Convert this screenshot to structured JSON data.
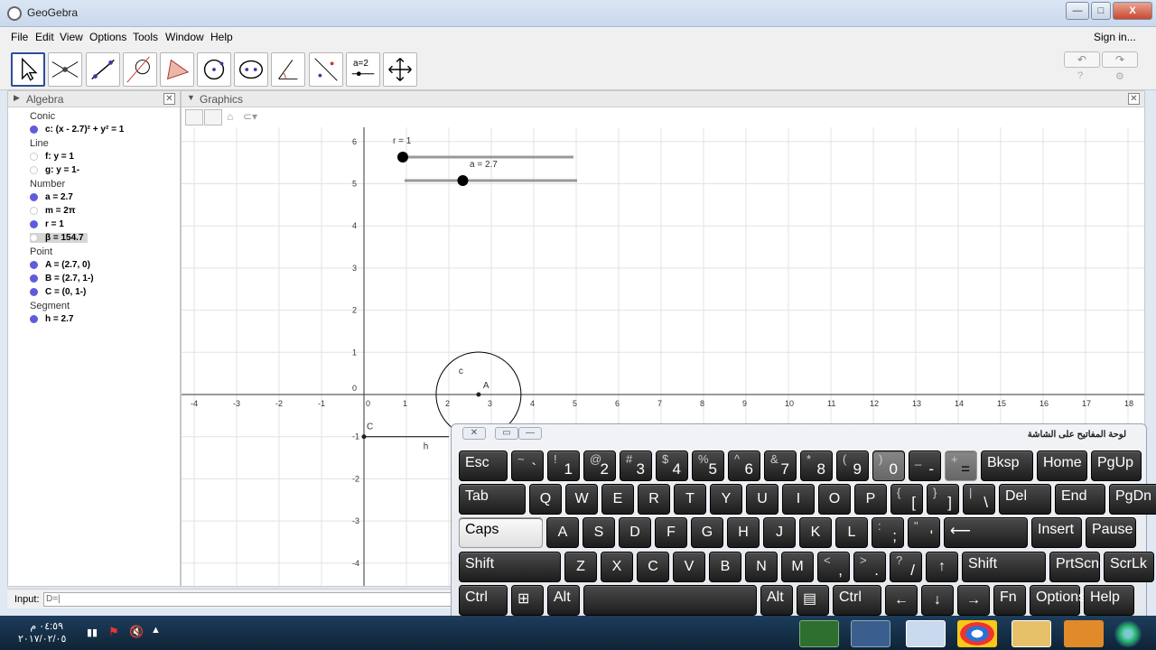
{
  "window": {
    "title": "GeoGebra",
    "min": "—",
    "max": "□",
    "close": "X"
  },
  "menu": [
    "File",
    "Edit",
    "View",
    "Options",
    "Tools",
    "Window",
    "Help"
  ],
  "signin": "Sign in...",
  "toolbar": {
    "slider_label": "a=2"
  },
  "algebra": {
    "title": "Algebra",
    "categories": {
      "conic": "Conic",
      "line": "Line",
      "number": "Number",
      "point": "Point",
      "segment": "Segment"
    },
    "items": [
      {
        "text": "c: (x - 2.7)² + y² = 1",
        "visible": true
      },
      {
        "text": "f: y = 1",
        "visible": false
      },
      {
        "text": "g: y = 1-",
        "visible": false
      },
      {
        "text": "a = 2.7",
        "visible": true
      },
      {
        "text": "m = 2π",
        "visible": false
      },
      {
        "text": "r = 1",
        "visible": true
      },
      {
        "text": "β = 154.7",
        "visible": false
      },
      {
        "text": "A = (2.7, 0)",
        "visible": true
      },
      {
        "text": "B = (2.7, 1-)",
        "visible": true
      },
      {
        "text": "C = (0, 1-)",
        "visible": true
      },
      {
        "text": "h = 2.7",
        "visible": true
      }
    ]
  },
  "graphics": {
    "title": "Graphics",
    "xticks": [
      "-4",
      "-3",
      "-2",
      "-1",
      "0",
      "1",
      "2",
      "3",
      "4",
      "5",
      "6",
      "7",
      "8",
      "9",
      "10",
      "11",
      "12",
      "13",
      "14",
      "15",
      "16",
      "17",
      "18"
    ],
    "yticks": [
      "6",
      "5",
      "4",
      "3",
      "2",
      "1",
      "0",
      "-1",
      "-2",
      "-3",
      "-4"
    ],
    "slider_r": "r = 1",
    "slider_a": "a = 2.7",
    "circle_label": "c",
    "point_label": "A",
    "pointC_label": "C",
    "seg_label": "h",
    "circle_center": [
      2.7,
      0
    ],
    "circle_radius": 1,
    "slider_r_value": 1,
    "slider_a_value": 2.7
  },
  "input": {
    "label": "Input:",
    "value": "D=|"
  },
  "osk": {
    "title": "لوحة المفاتيح على الشاشة",
    "rows": [
      [
        [
          "Esc"
        ],
        [
          "~",
          "`"
        ],
        [
          "!",
          "1"
        ],
        [
          "@",
          "2"
        ],
        [
          "#",
          "3"
        ],
        [
          "$",
          "4"
        ],
        [
          "%",
          "5"
        ],
        [
          "^",
          "6"
        ],
        [
          "&",
          "7"
        ],
        [
          "*",
          "8"
        ],
        [
          "(",
          "9"
        ],
        [
          ")",
          "0"
        ],
        [
          "_",
          "-"
        ],
        [
          "+",
          "="
        ],
        [
          "Bksp"
        ],
        [
          "Home"
        ],
        [
          "PgUp"
        ]
      ],
      [
        [
          "Tab"
        ],
        [
          "Q"
        ],
        [
          "W"
        ],
        [
          "E"
        ],
        [
          "R"
        ],
        [
          "T"
        ],
        [
          "Y"
        ],
        [
          "U"
        ],
        [
          "I"
        ],
        [
          "O"
        ],
        [
          "P"
        ],
        [
          "{",
          "["
        ],
        [
          "}",
          "]"
        ],
        [
          "|",
          "\\"
        ],
        [
          "Del"
        ],
        [
          "End"
        ],
        [
          "PgDn"
        ]
      ],
      [
        [
          "Caps"
        ],
        [
          "A"
        ],
        [
          "S"
        ],
        [
          "D"
        ],
        [
          "F"
        ],
        [
          "G"
        ],
        [
          "H"
        ],
        [
          "J"
        ],
        [
          "K"
        ],
        [
          "L"
        ],
        [
          ":",
          ";"
        ],
        [
          "\"",
          "'"
        ],
        [
          "Enter"
        ],
        [
          "Insert"
        ],
        [
          "Pause"
        ]
      ],
      [
        [
          "Shift"
        ],
        [
          "Z"
        ],
        [
          "X"
        ],
        [
          "C"
        ],
        [
          "V"
        ],
        [
          "B"
        ],
        [
          "N"
        ],
        [
          "M"
        ],
        [
          "<",
          ","
        ],
        [
          ">",
          "."
        ],
        [
          "?",
          "/"
        ],
        [
          "↑"
        ],
        [
          "Shift"
        ],
        [
          "PrtScn"
        ],
        [
          "ScrLk"
        ]
      ],
      [
        [
          "Ctrl"
        ],
        [
          "Win"
        ],
        [
          "Alt"
        ],
        [
          " "
        ],
        [
          "Alt"
        ],
        [
          "Menu"
        ],
        [
          "Ctrl"
        ],
        [
          "←"
        ],
        [
          "↓"
        ],
        [
          "→"
        ],
        [
          "Fn"
        ],
        [
          "Options"
        ],
        [
          "Help"
        ]
      ]
    ]
  },
  "clock": {
    "time": "٠٤:٥٩ م",
    "date": "٢٠١٧/٠٢/٠٥"
  }
}
